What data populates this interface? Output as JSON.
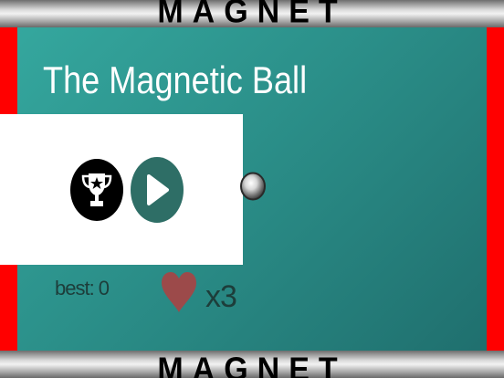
{
  "banner": {
    "top_text": "MAGNET",
    "bottom_text": "MAGNET"
  },
  "game": {
    "title": "The Magnetic Ball",
    "best_label": "best: 0",
    "lives_label": "x3"
  },
  "menu": {
    "trophy_icon": "trophy-icon",
    "play_icon": "play-icon"
  },
  "colors": {
    "background": "#2a8c86",
    "walls": "#ff0000",
    "panel": "#ffffff",
    "play_button": "#2e6e66",
    "heart": "#9c4a4a"
  }
}
